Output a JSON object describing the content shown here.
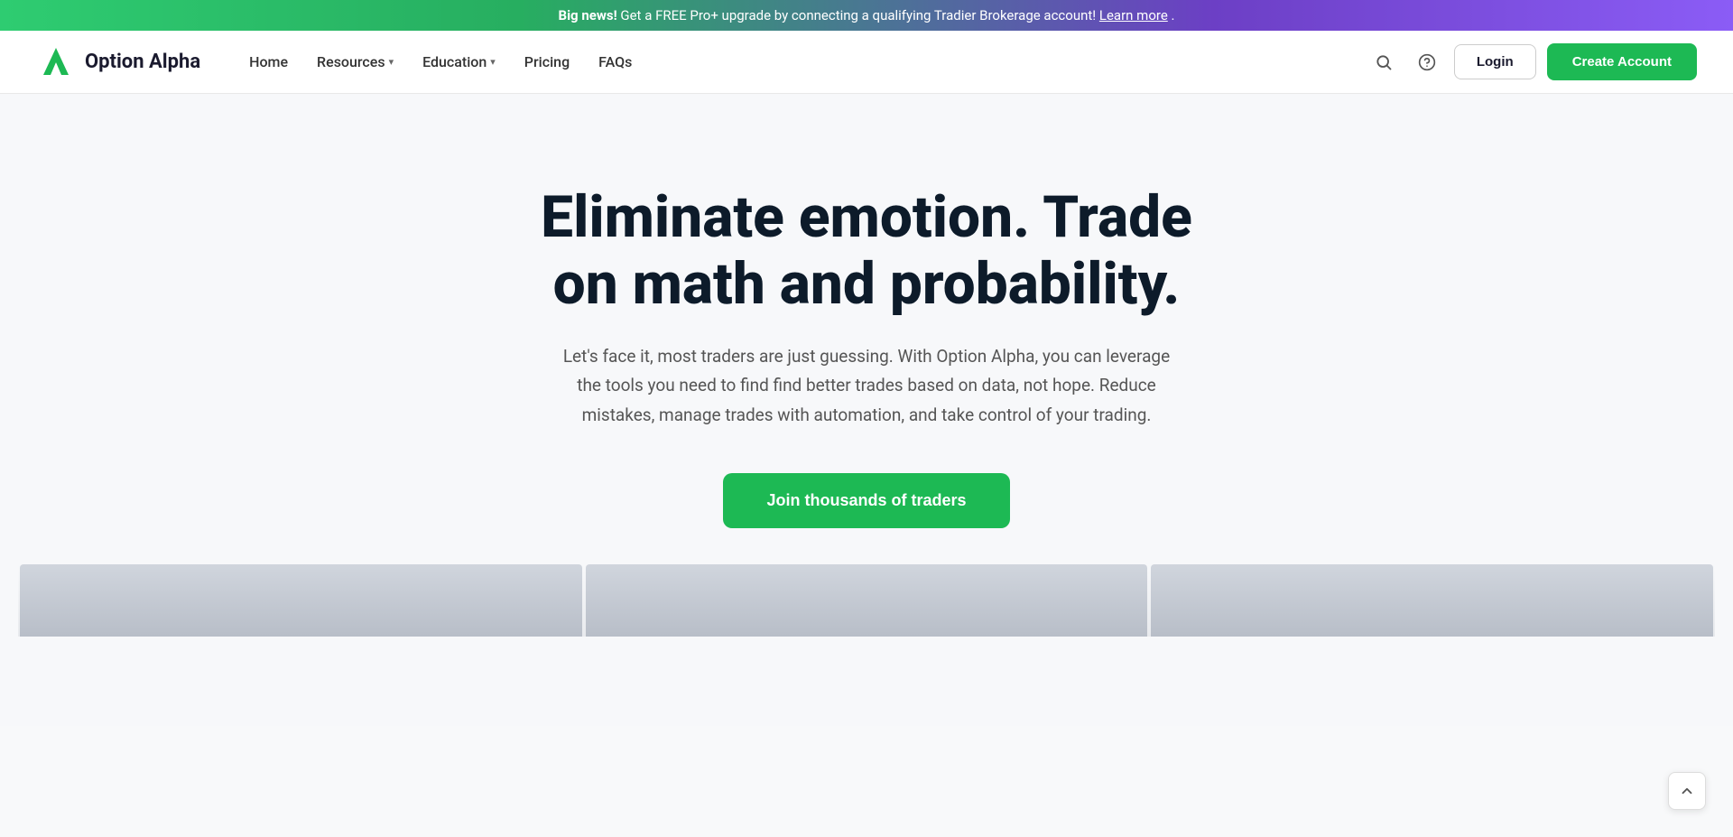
{
  "banner": {
    "bold_text": "Big news!",
    "text": " Get a FREE Pro+ upgrade by connecting a qualifying Tradier Brokerage account!",
    "link_text": "Learn more",
    "link_url": "#"
  },
  "navbar": {
    "logo_text": "Option Alpha",
    "nav_items": [
      {
        "label": "Home",
        "has_dropdown": false
      },
      {
        "label": "Resources",
        "has_dropdown": true
      },
      {
        "label": "Education",
        "has_dropdown": true
      },
      {
        "label": "Pricing",
        "has_dropdown": false
      },
      {
        "label": "FAQs",
        "has_dropdown": false
      }
    ],
    "login_label": "Login",
    "create_account_label": "Create Account"
  },
  "hero": {
    "title": "Eliminate emotion. Trade on math and probability.",
    "subtitle": "Let's face it, most traders are just guessing. With Option Alpha, you can leverage the tools you need to find find better trades based on data, not hope. Reduce mistakes, manage trades with automation, and take control of your trading.",
    "cta_label": "Join thousands of traders"
  },
  "scroll_top": {
    "icon": "chevron-up"
  },
  "icons": {
    "search": "🔍",
    "help": "?",
    "chevron_down": "▾",
    "chevron_up": "∧"
  }
}
